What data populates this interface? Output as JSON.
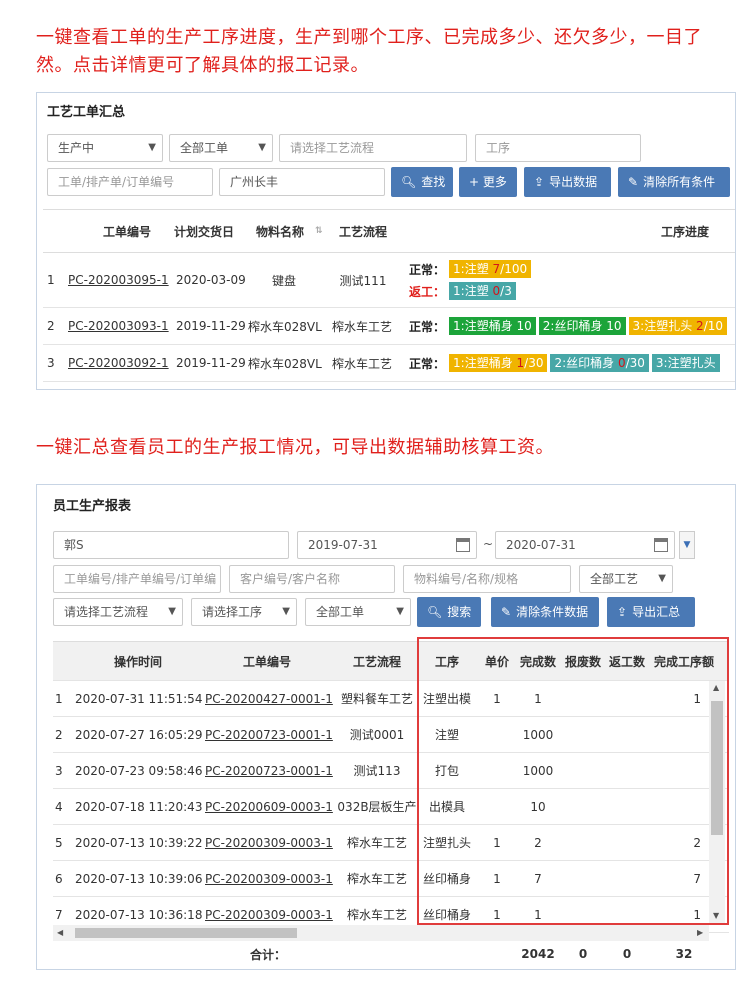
{
  "captions": {
    "top": "一键查看工单的生产工序进度，生产到哪个工序、已完成多少、还欠多少，一目了然。点击详情更可了解具体的报工记录。",
    "middle": "一键汇总查看员工的生产报工情况，可导出数据辅助核算工资。"
  },
  "panel1": {
    "title": "工艺工单汇总",
    "filters": {
      "status": "生产中",
      "order_scope": "全部工单",
      "process_flow_placeholder": "请选择工艺流程",
      "process_placeholder": "工序",
      "order_no_placeholder": "工单/排产单/订单编号",
      "customer_value": "广州长丰"
    },
    "buttons": {
      "search": "查找",
      "more": "+ 更多",
      "export": "导出数据",
      "clear": "清除所有条件"
    },
    "headers": {
      "order_no": "工单编号",
      "delivery": "计划交货日",
      "material": "物料名称",
      "flow": "工艺流程",
      "progress": "工序进度"
    },
    "rows": [
      {
        "idx": "1",
        "order_no": "PC-202003095-1",
        "delivery": "2020-03-09",
        "material": "键盘",
        "flow": "测试111",
        "normal_label": "正常：",
        "rework_label": "返工：",
        "normal_tags": [
          {
            "text": "1:注塑 ",
            "done": "7",
            "total": "/100",
            "color": "yellow"
          }
        ],
        "rework_tags": [
          {
            "text": "1:注塑 ",
            "done": "0",
            "total": "/3",
            "color": "teal"
          }
        ]
      },
      {
        "idx": "2",
        "order_no": "PC-202003093-1",
        "delivery": "2019-11-29",
        "material": "榨水车028VL",
        "flow": "榨水车工艺",
        "normal_label": "正常：",
        "normal_tags": [
          {
            "text": "1:注塑桶身 10",
            "done": "",
            "total": "",
            "color": "green"
          },
          {
            "text": "2:丝印桶身 10",
            "done": "",
            "total": "",
            "color": "green"
          },
          {
            "text": "3:注塑扎头 ",
            "done": "2",
            "total": "/10",
            "color": "yellow"
          }
        ]
      },
      {
        "idx": "3",
        "order_no": "PC-202003092-1",
        "delivery": "2019-11-29",
        "material": "榨水车028VL",
        "flow": "榨水车工艺",
        "normal_label": "正常：",
        "normal_tags": [
          {
            "text": "1:注塑桶身 ",
            "done": "1",
            "total": "/30",
            "color": "yellow"
          },
          {
            "text": "2:丝印桶身 ",
            "done": "0",
            "total": "/30",
            "color": "teal"
          },
          {
            "text": "3:注塑扎头",
            "done": "",
            "total": "",
            "color": "teal"
          }
        ]
      }
    ]
  },
  "panel2": {
    "title": "员工生产报表",
    "filters": {
      "employee": "郭S",
      "date_from": "2019-07-31",
      "date_sep": "~",
      "date_to": "2020-07-31",
      "order_no_placeholder": "工单编号/排产单编号/订单编",
      "customer_placeholder": "客户编号/客户名称",
      "material_placeholder": "物料编号/名称/规格",
      "process_scope": "全部工艺",
      "flow_select": "请选择工艺流程",
      "process_select": "请选择工序",
      "order_scope": "全部工单"
    },
    "buttons": {
      "search": "搜索",
      "clear": "清除条件数据",
      "export": "导出汇总"
    },
    "headers": {
      "time": "操作时间",
      "order_no": "工单编号",
      "flow": "工艺流程",
      "process": "工序",
      "price": "单价",
      "done": "完成数",
      "scrap": "报废数",
      "rework": "返工数",
      "amount": "完成工序额"
    },
    "rows": [
      {
        "idx": "1",
        "time": "2020-07-31 11:51:54",
        "order_no": "PC-20200427-0001-1",
        "flow": "塑料餐车工艺",
        "process": "注塑出模",
        "price": "1",
        "done": "1",
        "scrap": "",
        "rework": "",
        "amount": "1"
      },
      {
        "idx": "2",
        "time": "2020-07-27 16:05:29",
        "order_no": "PC-20200723-0001-1",
        "flow": "测试0001",
        "process": "注塑",
        "price": "",
        "done": "1000",
        "scrap": "",
        "rework": "",
        "amount": ""
      },
      {
        "idx": "3",
        "time": "2020-07-23 09:58:46",
        "order_no": "PC-20200723-0001-1",
        "flow": "测试113",
        "process": "打包",
        "price": "",
        "done": "1000",
        "scrap": "",
        "rework": "",
        "amount": ""
      },
      {
        "idx": "4",
        "time": "2020-07-18 11:20:43",
        "order_no": "PC-20200609-0003-1",
        "flow": "032B层板生产",
        "process": "出模具",
        "price": "",
        "done": "10",
        "scrap": "",
        "rework": "",
        "amount": ""
      },
      {
        "idx": "5",
        "time": "2020-07-13 10:39:22",
        "order_no": "PC-20200309-0003-1",
        "flow": "榨水车工艺",
        "process": "注塑扎头",
        "price": "1",
        "done": "2",
        "scrap": "",
        "rework": "",
        "amount": "2"
      },
      {
        "idx": "6",
        "time": "2020-07-13 10:39:06",
        "order_no": "PC-20200309-0003-1",
        "flow": "榨水车工艺",
        "process": "丝印桶身",
        "price": "1",
        "done": "7",
        "scrap": "",
        "rework": "",
        "amount": "7"
      },
      {
        "idx": "7",
        "time": "2020-07-13 10:36:18",
        "order_no": "PC-20200309-0003-1",
        "flow": "榨水车工艺",
        "process": "丝印桶身",
        "price": "1",
        "done": "1",
        "scrap": "",
        "rework": "",
        "amount": "1"
      }
    ],
    "footer": {
      "label": "合计：",
      "done": "2042",
      "scrap": "0",
      "rework": "0",
      "amount": "32"
    }
  },
  "colors": {
    "caption": "#e0201c",
    "button": "#4a79b5",
    "green_tag": "#1ca43a",
    "yellow_tag": "#f0b400",
    "teal_tag": "#47a7a7",
    "highlight_box": "#e03c3c"
  }
}
